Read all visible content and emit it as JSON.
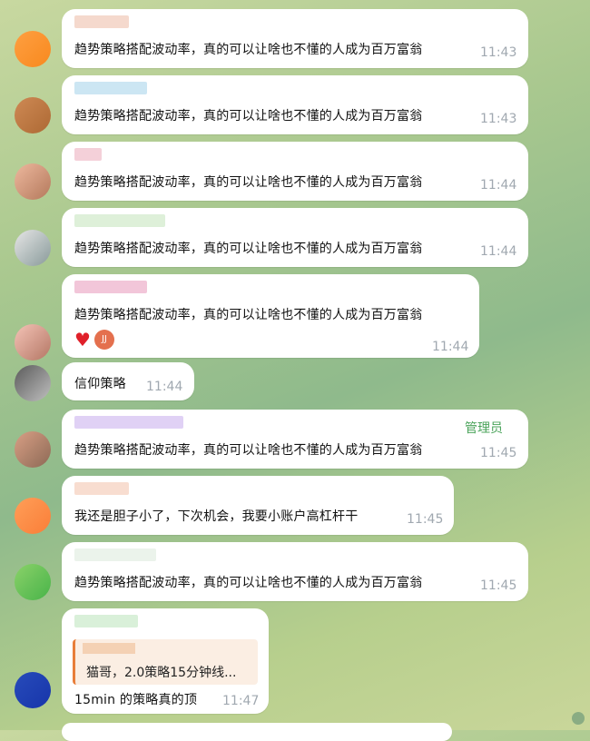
{
  "messages": [
    {
      "text": "趋势策略搭配波动率，真的可以让啥也不懂的人成为百万富翁",
      "time": "11:43"
    },
    {
      "text": "趋势策略搭配波动率，真的可以让啥也不懂的人成为百万富翁",
      "time": "11:43"
    },
    {
      "text": "趋势策略搭配波动率，真的可以让啥也不懂的人成为百万富翁",
      "time": "11:44"
    },
    {
      "text": "趋势策略搭配波动率，真的可以让啥也不懂的人成为百万富翁",
      "time": "11:44"
    },
    {
      "text": "趋势策略搭配波动率，真的可以让啥也不懂的人成为百万富翁",
      "time": "11:44",
      "reaction_avatar": "JJ"
    },
    {
      "text": "信仰策略",
      "time": "11:44"
    },
    {
      "text": "趋势策略搭配波动率，真的可以让啥也不懂的人成为百万富翁",
      "time": "11:45",
      "badge": "管理员"
    },
    {
      "text": "我还是胆子小了，下次机会，我要小账户高杠杆干",
      "time": "11:45"
    },
    {
      "text": "趋势策略搭配波动率，真的可以让啥也不懂的人成为百万富翁",
      "time": "11:45"
    },
    {
      "text": "15min 的策略真的顶",
      "time": "11:47",
      "quote": "猫哥，2.0策略15分钟线..."
    }
  ],
  "colors": {
    "accent_admin": "#4aa35a",
    "quote_bar": "#e87e3a",
    "heart": "#e0202a"
  }
}
